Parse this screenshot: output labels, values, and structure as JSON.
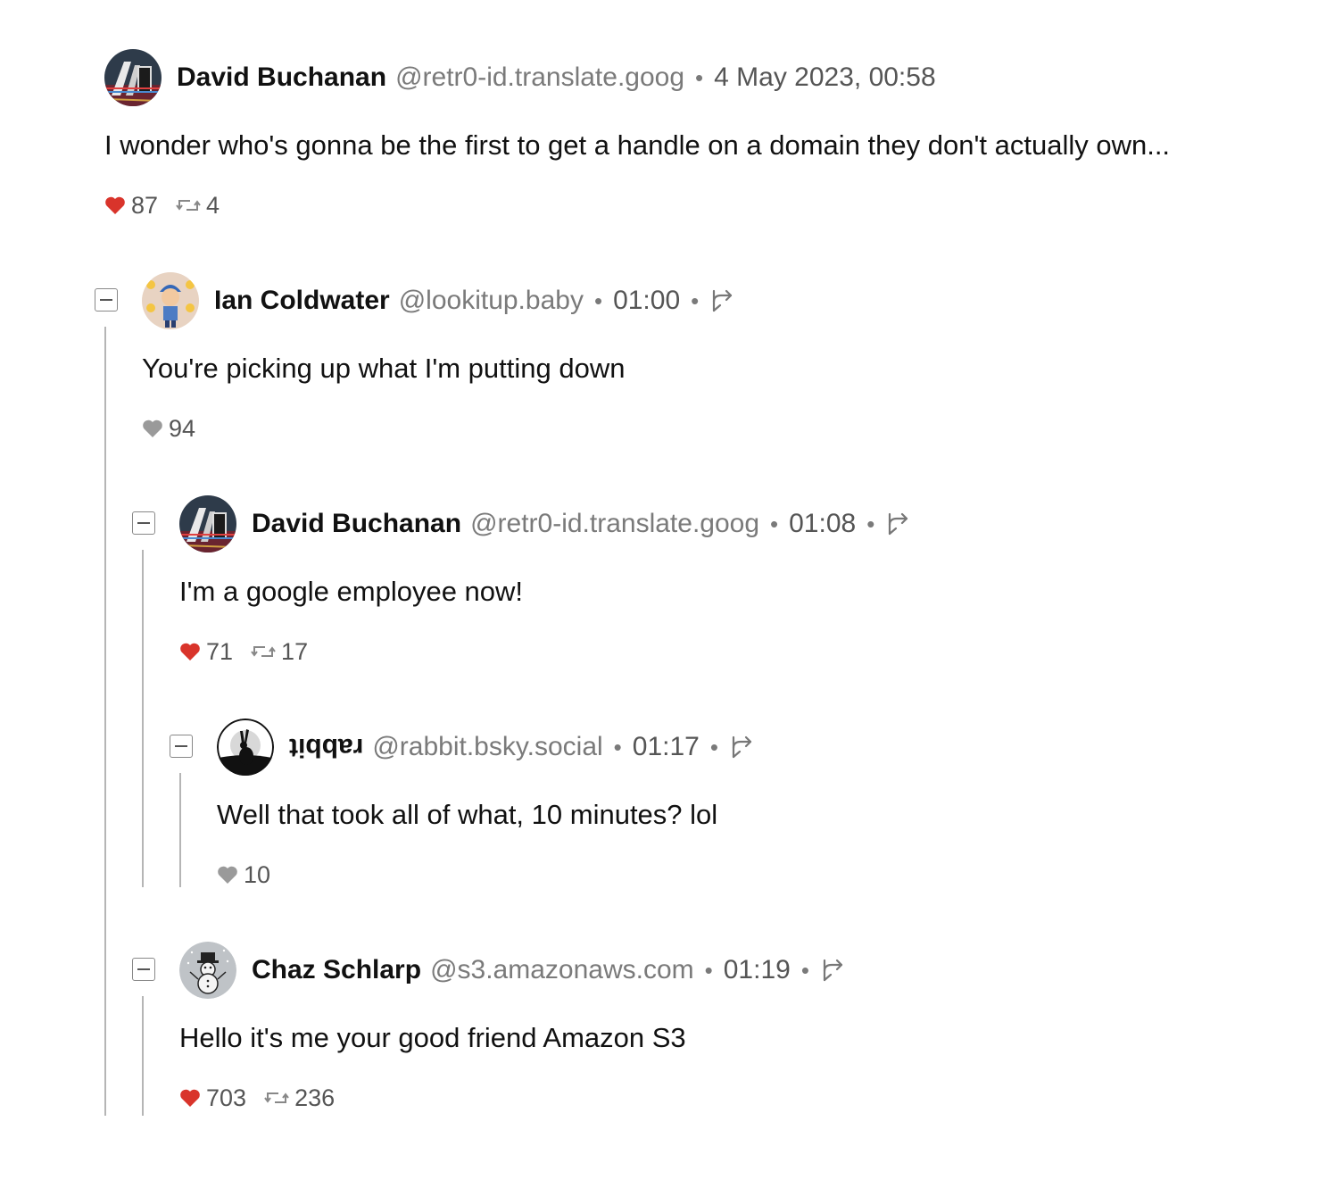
{
  "posts": [
    {
      "name": "David Buchanan",
      "handle": "@retr0-id.translate.goog",
      "sep": "•",
      "time": "4 May 2023, 00:58",
      "text": "I wonder who's gonna be the first to get a handle on a domain they don't actually own...",
      "likes": "87",
      "reposts": "4",
      "liked": true,
      "avatar_icon": "retro-computer-avatar"
    },
    {
      "name": "Ian Coldwater",
      "handle": "@lookitup.baby",
      "sep": "•",
      "time": "01:00",
      "text": "You're picking up what I'm putting down",
      "likes": "94",
      "liked": false,
      "avatar_icon": "cartoon-character-avatar"
    },
    {
      "name": "David Buchanan",
      "handle": "@retr0-id.translate.goog",
      "sep": "•",
      "time": "01:08",
      "text": "I'm a google employee now!",
      "likes": "71",
      "reposts": "17",
      "liked": true,
      "avatar_icon": "retro-computer-avatar"
    },
    {
      "name": "rabbit",
      "handle": "@rabbit.bsky.social",
      "sep": "•",
      "time": "01:17",
      "text": "Well that took all of what, 10 minutes? lol",
      "likes": "10",
      "liked": false,
      "avatar_icon": "rabbit-moon-avatar"
    },
    {
      "name": "Chaz Schlarp",
      "handle": "@s3.amazonaws.com",
      "sep": "•",
      "time": "01:19",
      "text": "Hello it's me your good friend Amazon S3",
      "likes": "703",
      "reposts": "236",
      "liked": true,
      "avatar_icon": "snowman-avatar"
    }
  ],
  "colors": {
    "like_active": "#d9342b",
    "like_inactive": "#9a9a9a",
    "muted_text": "#7a7a7a",
    "thread_line": "#b5b5b5"
  }
}
